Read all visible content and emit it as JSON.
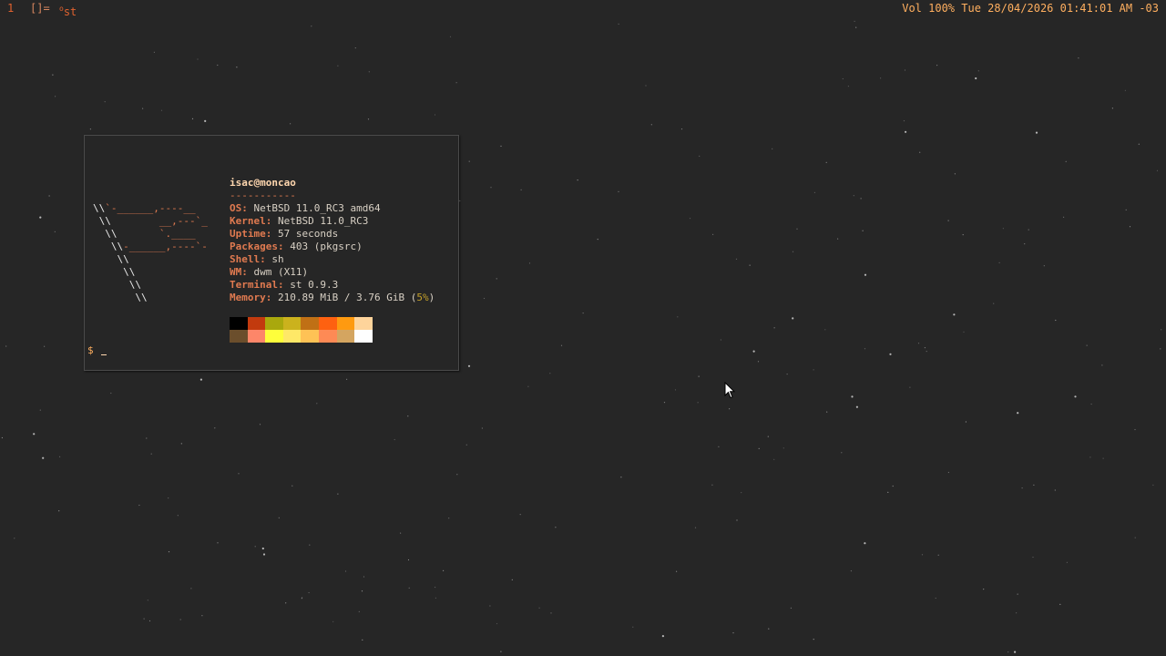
{
  "topbar": {
    "tag": "1",
    "layout": "[]=",
    "window_title_mark": "o",
    "window_title": "st",
    "status": "Vol 100% Tue 28/04/2026 01:41:01 AM -03"
  },
  "terminal": {
    "user_host": "isac@moncao",
    "separator": "-----------",
    "info": [
      {
        "key": "OS",
        "value": "NetBSD 11.0_RC3 amd64"
      },
      {
        "key": "Kernel",
        "value": "NetBSD 11.0_RC3"
      },
      {
        "key": "Uptime",
        "value": "57 seconds"
      },
      {
        "key": "Packages",
        "value": "403 (pkgsrc)"
      },
      {
        "key": "Shell",
        "value": "sh"
      },
      {
        "key": "WM",
        "value": "dwm (X11)"
      },
      {
        "key": "Terminal",
        "value": "st 0.9.3"
      },
      {
        "key": "Memory",
        "value": "210.89 MiB / 3.76 GiB ("
      }
    ],
    "memory_percent": "5%",
    "memory_close": ")",
    "key_suffix": ": ",
    "palette_top": [
      "#000000",
      "#c23a0e",
      "#a9a80d",
      "#cbb21d",
      "#c07015",
      "#fe6110",
      "#fe9a10",
      "#fed49b"
    ],
    "palette_bottom": [
      "#6b4e2c",
      "#fd8669",
      "#fefe3b",
      "#fee867",
      "#fec255",
      "#fe8a55",
      "#d4a560",
      "#fefefe"
    ],
    "prompt": "$",
    "logo": {
      "l1a": "\\\\",
      "l1b": "`-______,----__",
      "l2a": " \\\\",
      "l2b": "        __,---`_",
      "l3a": "  \\\\",
      "l3b": "       `.____",
      "l4a": "   \\\\",
      "l4b": "-______,----`-",
      "l5a": "    \\\\",
      "l6a": "     \\\\",
      "l7a": "      \\\\",
      "l8a": "       \\\\"
    }
  },
  "colors": {
    "background": "#262626",
    "accent": "#e07a50",
    "status": "#ffaf5f"
  }
}
